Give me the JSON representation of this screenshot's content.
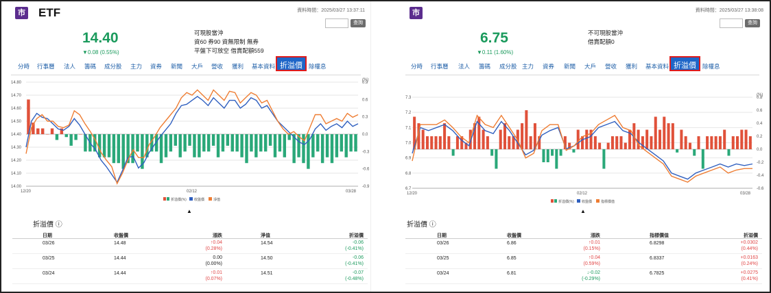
{
  "colors": {
    "red": "#e0513a",
    "green": "#2aa879",
    "blue": "#2f5fbf",
    "orange": "#ee7d33",
    "tab_link": "#2060a8",
    "highlight_border": "#e01b1b"
  },
  "panels": [
    {
      "badge": "市",
      "title": "ETF",
      "updated": "資料時間：2025/03/27 13:37:11",
      "search_button": "查詢",
      "price": "14.40",
      "change": "▼0.08 (0.55%)",
      "info_lines": [
        "可現股當沖",
        "資60 券90 資無限制 無券",
        "平盤下可放空 借賣配額559"
      ],
      "tabs": [
        "分時",
        "行事曆",
        "法人",
        "籌碼",
        "成分股",
        "主力",
        "資券",
        "新聞",
        "大戶",
        "營收",
        "獲利",
        "基本資料",
        "折溢價",
        "除權息"
      ],
      "active_tab": "折溢價",
      "chart_data": {
        "type": "line",
        "y_left_ticks": [
          "14.80",
          "14.70",
          "14.60",
          "14.50",
          "14.40",
          "14.30",
          "14.20",
          "14.10",
          "14.00"
        ],
        "y_right_ticks": [
          "(%)",
          "0.9",
          "0.6",
          "0.3",
          "0.0",
          "-0.3",
          "-0.6",
          "-0.9"
        ],
        "x_ticks": [
          "12/20",
          "02/12",
          "03/28"
        ],
        "legend": [
          "折溢價(%)",
          "收盤價",
          "淨值"
        ],
        "ylim_left": [
          14.0,
          14.8
        ],
        "ylim_right": [
          -0.9,
          0.9
        ],
        "series": [
          {
            "name": "折溢價(%)",
            "color": "#e0513a",
            "values": [
              0.6,
              0.2,
              0.1,
              0.1,
              0.0,
              0.1,
              -0.1,
              0.1,
              -0.05,
              -0.2,
              -0.1,
              0.0,
              -0.3,
              -0.3,
              -0.3,
              -0.4,
              -0.4,
              -0.4,
              -0.5,
              -0.5,
              -0.6,
              -0.5,
              -0.5,
              -0.3,
              -0.6,
              -0.4,
              -0.3,
              -0.3,
              -0.5,
              -0.4,
              -0.3,
              -0.2,
              -0.4,
              -0.3,
              -0.2,
              -0.4,
              -0.4,
              -0.3,
              -0.3,
              -0.2,
              -0.4,
              -0.3,
              -0.2,
              -0.3,
              -0.3,
              -0.4,
              -0.5,
              -0.3,
              -0.4,
              -0.3,
              -0.3,
              -0.2,
              -0.4,
              -0.3,
              -0.4,
              -0.1,
              -0.5,
              -0.4,
              -0.5,
              -0.6,
              -0.4,
              -0.3,
              -0.5,
              -0.4,
              -0.5,
              -0.4,
              -0.3,
              -0.4,
              -0.3,
              -0.3
            ]
          },
          {
            "name": "收盤價",
            "color": "#2f5fbf",
            "values": [
              14.3,
              14.5,
              14.56,
              14.53,
              14.52,
              14.48,
              14.44,
              14.43,
              14.46,
              14.52,
              14.47,
              14.4,
              14.33,
              14.28,
              14.2,
              14.15,
              14.09,
              14.03,
              14.12,
              14.22,
              14.23,
              14.14,
              14.18,
              14.26,
              14.32,
              14.38,
              14.43,
              14.48,
              14.56,
              14.62,
              14.63,
              14.66,
              14.69,
              14.66,
              14.62,
              14.68,
              14.64,
              14.6,
              14.66,
              14.66,
              14.6,
              14.63,
              14.68,
              14.66,
              14.6,
              14.62,
              14.56,
              14.5,
              14.46,
              14.42,
              14.38,
              14.34,
              14.32,
              14.36,
              14.44,
              14.48,
              14.43,
              14.46,
              14.48,
              14.45,
              14.5,
              14.46,
              14.48
            ]
          },
          {
            "name": "淨值",
            "color": "#ee7d33",
            "values": [
              14.25,
              14.45,
              14.52,
              14.55,
              14.5,
              14.5,
              14.46,
              14.45,
              14.47,
              14.58,
              14.55,
              14.48,
              14.42,
              14.35,
              14.26,
              14.2,
              14.15,
              14.02,
              14.1,
              14.2,
              14.28,
              14.22,
              14.22,
              14.32,
              14.38,
              14.45,
              14.5,
              14.55,
              14.6,
              14.68,
              14.72,
              14.7,
              14.74,
              14.7,
              14.66,
              14.74,
              14.7,
              14.66,
              14.73,
              14.72,
              14.64,
              14.68,
              14.72,
              14.7,
              14.64,
              14.66,
              14.58,
              14.5,
              14.44,
              14.4,
              14.42,
              14.38,
              14.35,
              14.45,
              14.55,
              14.55,
              14.48,
              14.5,
              14.52,
              14.5,
              14.56,
              14.53,
              14.55
            ]
          }
        ]
      },
      "section_title": "折溢價",
      "table": {
        "headers": [
          "日期",
          "收盤價",
          "漲跌",
          "淨值",
          "折溢價"
        ],
        "rows": [
          {
            "date": "03/26",
            "close": "14.48",
            "chg": "↑0.04",
            "chg_pct": "(0.28%)",
            "chg_dir": "up",
            "ref": "14.54",
            "prem": "-0.06",
            "prem_pct": "(-0.41%)",
            "prem_dir": "dn"
          },
          {
            "date": "03/25",
            "close": "14.44",
            "chg": "0.00",
            "chg_pct": "(0.00%)",
            "chg_dir": "flat",
            "ref": "14.50",
            "prem": "-0.06",
            "prem_pct": "(-0.41%)",
            "prem_dir": "dn"
          },
          {
            "date": "03/24",
            "close": "14.44",
            "chg": "↑0.01",
            "chg_pct": "(0.07%)",
            "chg_dir": "up",
            "ref": "14.51",
            "prem": "-0.07",
            "prem_pct": "(-0.48%)",
            "prem_dir": "dn"
          }
        ]
      }
    },
    {
      "badge": "市",
      "title": "",
      "updated": "資料時間：2025/03/27 13:38:08",
      "search_button": "查詢",
      "price": "6.75",
      "change": "▼0.11 (1.60%)",
      "info_lines": [
        "不可現股當沖",
        "借賣配額0"
      ],
      "tabs": [
        "分時",
        "行事曆",
        "法人",
        "籌碼",
        "成分股",
        "主力",
        "資券",
        "新聞",
        "大戶",
        "營收",
        "獲利",
        "基本資料",
        "折溢價",
        "除權息"
      ],
      "active_tab": "折溢價",
      "chart_data": {
        "type": "line",
        "y_left_ticks": [
          "7.3",
          "7.2",
          "7.1",
          "7.0",
          "6.9",
          "6.8",
          "6.7"
        ],
        "y_right_ticks": [
          "(%)",
          "0.8",
          "0.6",
          "0.4",
          "0.2",
          "0.0",
          "-0.2",
          "-0.4",
          "-0.6"
        ],
        "x_ticks": [
          "12/20",
          "02/12",
          "03/28"
        ],
        "legend": [
          "折溢價(%)",
          "收盤價",
          "指標價值"
        ],
        "ylim_left": [
          6.7,
          7.3
        ],
        "ylim_right": [
          -0.6,
          0.8
        ],
        "series": [
          {
            "name": "折溢價(%)",
            "color": "#e0513a",
            "values": [
              0.5,
              0.4,
              0.3,
              0.2,
              0.2,
              0.2,
              0.2,
              0.4,
              0.2,
              -0.1,
              0.2,
              0.2,
              0.1,
              0.3,
              0.4,
              0.5,
              0.3,
              0.2,
              -0.1,
              -0.3,
              0.3,
              0.4,
              0.2,
              0.2,
              0.3,
              0.4,
              0.6,
              0.2,
              0.4,
              0.2,
              -0.2,
              -0.2,
              -0.1,
              -0.3,
              -0.1,
              0.2,
              0.1,
              -0.05,
              0.3,
              0.2,
              0.3,
              0.3,
              0.2,
              0.1,
              -0.3,
              0.1,
              0.2,
              0.2,
              0.2,
              0.1,
              0.3,
              0.4,
              0.3,
              0.2,
              0.3,
              0.2,
              0.5,
              0.3,
              0.5,
              0.4,
              0.4,
              -0.05,
              0.3,
              0.2,
              0.1,
              -0.1,
              0.2,
              -0.3,
              0.2,
              0.2,
              0.2,
              0.2,
              0.3,
              -0.1,
              0.2,
              0.2,
              0.3,
              0.3,
              0.2
            ]
          },
          {
            "name": "收盤價",
            "color": "#2f5fbf",
            "values": [
              6.93,
              7.1,
              7.08,
              7.1,
              7.12,
              7.08,
              7.02,
              6.98,
              7.14,
              7.08,
              7.06,
              7.14,
              7.08,
              7.0,
              6.92,
              6.95,
              7.05,
              7.08,
              7.1,
              6.96,
              6.98,
              7.02,
              7.04,
              7.1,
              7.12,
              7.14,
              7.08,
              7.06,
              7.0,
              6.96,
              6.92,
              6.88,
              6.8,
              6.78,
              6.76,
              6.8,
              6.82,
              6.84,
              6.86,
              6.84,
              6.86,
              6.85,
              6.86
            ]
          },
          {
            "name": "指標價值",
            "color": "#ee7d33",
            "values": [
              6.88,
              7.12,
              7.12,
              7.12,
              7.15,
              7.1,
              7.04,
              7.0,
              7.18,
              7.12,
              7.1,
              7.18,
              7.1,
              7.02,
              6.9,
              6.93,
              7.08,
              7.12,
              7.12,
              6.95,
              6.98,
              7.04,
              7.06,
              7.12,
              7.15,
              7.18,
              7.1,
              7.08,
              6.98,
              6.94,
              6.9,
              6.86,
              6.78,
              6.76,
              6.74,
              6.78,
              6.8,
              6.82,
              6.84,
              6.8,
              6.82,
              6.83,
              6.83
            ]
          }
        ]
      },
      "section_title": "折溢價",
      "table": {
        "headers": [
          "日期",
          "收盤價",
          "漲跌",
          "指標價值",
          "折溢價"
        ],
        "rows": [
          {
            "date": "03/26",
            "close": "6.86",
            "chg": "↑0.01",
            "chg_pct": "(0.15%)",
            "chg_dir": "up",
            "ref": "6.8298",
            "prem": "+0.0302",
            "prem_pct": "(0.44%)",
            "prem_dir": "up"
          },
          {
            "date": "03/25",
            "close": "6.85",
            "chg": "↑0.04",
            "chg_pct": "(0.59%)",
            "chg_dir": "up",
            "ref": "6.8337",
            "prem": "+0.0163",
            "prem_pct": "(0.24%)",
            "prem_dir": "up"
          },
          {
            "date": "03/24",
            "close": "6.81",
            "chg": "↓-0.02",
            "chg_pct": "(-0.29%)",
            "chg_dir": "dn",
            "ref": "6.7825",
            "prem": "+0.0275",
            "prem_pct": "(0.41%)",
            "prem_dir": "up"
          }
        ]
      }
    }
  ]
}
